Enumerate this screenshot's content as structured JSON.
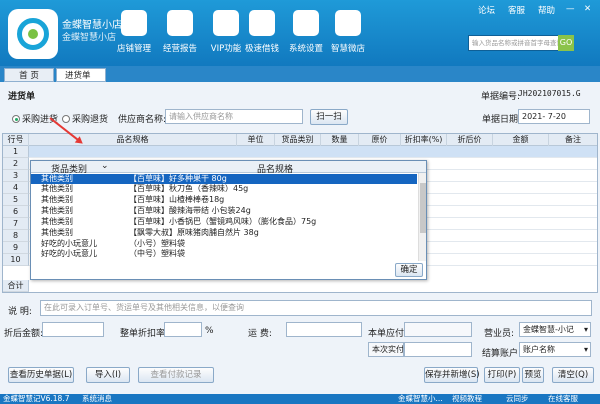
{
  "header": {
    "shop_name": "金蝶智慧小店",
    "shop_sub": "金蝶智慧小店",
    "nav": [
      {
        "label": "店铺管理",
        "icon": "store-icon"
      },
      {
        "label": "经营报告",
        "icon": "report-icon"
      },
      {
        "label": "VIP功能",
        "icon": "vip-icon"
      },
      {
        "label": "极速借钱",
        "icon": "money-icon"
      },
      {
        "label": "系统设置",
        "icon": "gear-icon"
      },
      {
        "label": "智慧微店",
        "icon": "microstore-icon"
      }
    ],
    "top_links": {
      "forum": "论坛",
      "service": "客服",
      "help": "帮助"
    },
    "search_placeholder": "输入货品名称或拼音首字母查询",
    "search_button": "GO"
  },
  "tabs": {
    "home": "首 页",
    "purchase": "进货单"
  },
  "form": {
    "title": "进货单",
    "order_no_label": "单据编号:",
    "order_no": "JH202107015.G",
    "radio_purchase": "采购进货",
    "radio_return": "采购退货",
    "supplier_label": "供应商名称:",
    "supplier_placeholder": "请输入供应商名称",
    "scan_button": "扫一扫",
    "date_label": "单据日期:",
    "date_value": "2021- 7-20"
  },
  "grid": {
    "columns": [
      "行号",
      "品名规格",
      "单位",
      "货品类别",
      "数量",
      "原价",
      "折扣率(%)",
      "折后价",
      "金额",
      "备注"
    ],
    "rows": [
      "1",
      "2",
      "3",
      "4",
      "5",
      "6",
      "7",
      "8",
      "9",
      "10"
    ],
    "total_label": "合计"
  },
  "popup": {
    "col_category": "货品类别",
    "col_name": "品名规格",
    "items": [
      {
        "category": "其他类别",
        "name": "【百草味】好多种果干 80g",
        "selected": true
      },
      {
        "category": "其他类别",
        "name": "【百草味】秋刀鱼（香辣味）45g",
        "selected": false
      },
      {
        "category": "其他类别",
        "name": "【百草味】山楂棒棒卷18g",
        "selected": false
      },
      {
        "category": "其他类别",
        "name": "【百草味】酸辣海带结 小包装24g",
        "selected": false
      },
      {
        "category": "其他类别",
        "name": "【百草味】小香锅巴（蟹镜鸡风味）（膨化食品）75g",
        "selected": false
      },
      {
        "category": "其他类别",
        "name": "【飘零大叔】原味猪肉脯自然片 38g",
        "selected": false
      },
      {
        "category": "好吃的小玩意儿",
        "name": "（小号）塑料袋",
        "selected": false
      },
      {
        "category": "好吃的小玩意儿",
        "name": "（中号）塑料袋",
        "selected": false
      }
    ],
    "ok_button": "确定"
  },
  "footer": {
    "note_label": "说   明:",
    "note_placeholder": "在此可录入订单号、货运单号及其他相关信息，以便查询",
    "discount_amount_label": "折后金额:",
    "discount_rate_label": "整单折扣率:",
    "percent": "%",
    "freight_label": "运    费:",
    "payable_label": "本单应付:",
    "actual_label": "本次实付",
    "salesperson_label": "营业员:",
    "salesperson_value": "金蝶智慧-小记",
    "account_label": "结算账户:",
    "account_value": "账户名称",
    "buttons": {
      "history": "查看历史单据(L)",
      "import": "导入(I)",
      "view_payment": "查看付款记录",
      "save_new": "保存并新增(S)",
      "print": "打印(P)",
      "preview": "预览",
      "clear": "清空(Q)"
    }
  },
  "statusbar": {
    "version": "金蝶智慧记V6.18.7",
    "messages": "系统消息",
    "shop": "金蝶智慧小...",
    "video": "视频教程",
    "cloud": "云同步",
    "online": "在线客服"
  }
}
